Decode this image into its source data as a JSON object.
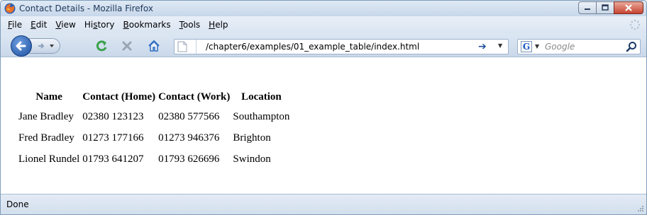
{
  "window": {
    "title": "Contact Details - Mozilla Firefox"
  },
  "menu": {
    "items": [
      {
        "label": "File",
        "accel": "F",
        "rest": "ile"
      },
      {
        "label": "Edit",
        "accel": "E",
        "rest": "dit"
      },
      {
        "label": "View",
        "accel": "V",
        "rest": "iew"
      },
      {
        "label": "History",
        "accel": "s",
        "pre": "Hi",
        "rest": "tory"
      },
      {
        "label": "Bookmarks",
        "accel": "B",
        "rest": "ookmarks"
      },
      {
        "label": "Tools",
        "accel": "T",
        "rest": "ools"
      },
      {
        "label": "Help",
        "accel": "H",
        "rest": "elp"
      }
    ]
  },
  "navigation": {
    "url": "/chapter6/examples/01_example_table/index.html",
    "search_placeholder": "Google"
  },
  "table": {
    "headers": [
      "Name",
      "Contact (Home)",
      "Contact (Work)",
      "Location"
    ],
    "rows": [
      [
        "Jane Bradley",
        "02380 123123",
        "02380 577566",
        "Southampton"
      ],
      [
        "Fred Bradley",
        "01273 177166",
        "01273 946376",
        "Brighton"
      ],
      [
        "Lionel Rundel",
        "01793 641207",
        "01793 626696",
        "Swindon"
      ]
    ]
  },
  "status": {
    "text": "Done"
  },
  "colors": {
    "accent": "#1b4e9f",
    "reload_green": "#3aa14a",
    "stop_gray": "#9aa5b4",
    "home_blue": "#2f6fc2"
  },
  "icons": [
    "firefox-icon",
    "back-arrow-icon",
    "forward-arrow-icon",
    "reload-icon",
    "stop-icon",
    "home-icon",
    "page-icon",
    "go-arrow-icon",
    "google-icon",
    "search-icon",
    "minimize-icon",
    "maximize-icon",
    "close-icon"
  ]
}
